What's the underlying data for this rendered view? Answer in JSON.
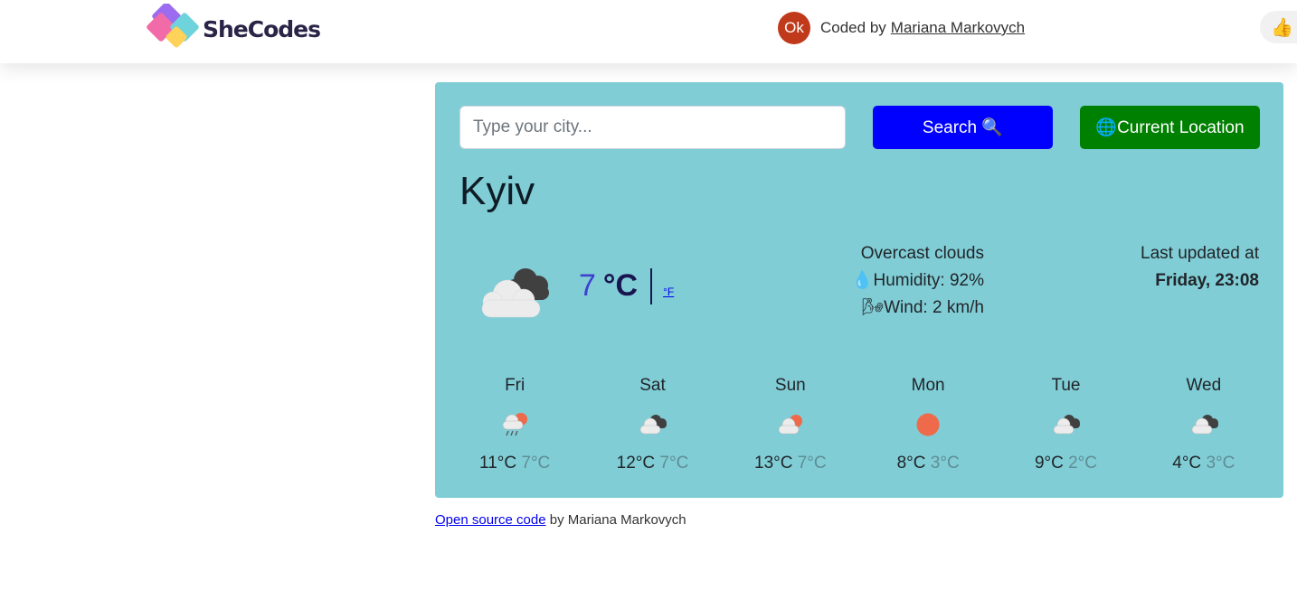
{
  "header": {
    "logo_text": "SheCodes",
    "avatar_initials": "Ok",
    "credit_prefix": "Coded by",
    "credit_name": "Mariana Markovych",
    "like_icon": "thumbs-up-icon"
  },
  "search": {
    "placeholder": "Type your city...",
    "search_label": "Search 🔍",
    "location_label": "🌐Current Location"
  },
  "current": {
    "city": "Kyiv",
    "temperature": "7",
    "unit_c": "°C",
    "unit_f": "°F",
    "description": "Overcast clouds",
    "humidity": "💧Humidity: 92%",
    "wind": "🌬Wind: 2 km/h",
    "updated_label": "Last updated at",
    "updated_time": "Friday, 23:08",
    "icon": "overcast-clouds-icon"
  },
  "forecast": [
    {
      "day": "Fri",
      "max": "11°C",
      "min": "7°C",
      "icon": "rain-sun-icon"
    },
    {
      "day": "Sat",
      "max": "12°C",
      "min": "7°C",
      "icon": "broken-clouds-icon"
    },
    {
      "day": "Sun",
      "max": "13°C",
      "min": "7°C",
      "icon": "partly-cloudy-icon"
    },
    {
      "day": "Mon",
      "max": "8°C",
      "min": "3°C",
      "icon": "clear-sun-icon"
    },
    {
      "day": "Tue",
      "max": "9°C",
      "min": "2°C",
      "icon": "broken-clouds-icon"
    },
    {
      "day": "Wed",
      "max": "4°C",
      "min": "3°C",
      "icon": "broken-clouds-icon"
    }
  ],
  "footer": {
    "link_text": "Open source code",
    "suffix": "by Mariana Markovych"
  },
  "colors": {
    "card_bg": "#80cdd6",
    "search_btn": "#0000ff",
    "location_btn": "#008000",
    "sun": "#ee6a4a"
  }
}
